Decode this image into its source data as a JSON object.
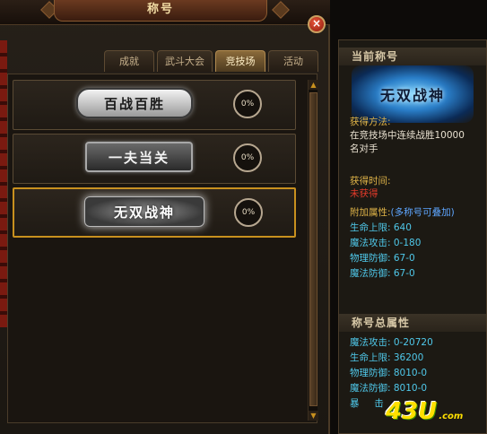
{
  "window": {
    "title": "称号",
    "close_label": "×"
  },
  "tabs": [
    {
      "label": "成就",
      "active": false
    },
    {
      "label": "武斗大会",
      "active": false
    },
    {
      "label": "竞技场",
      "active": true
    },
    {
      "label": "活动",
      "active": false
    }
  ],
  "titles": [
    {
      "badge_text": "百战百胜",
      "progress": "0%",
      "selected": false
    },
    {
      "badge_text": "一夫当关",
      "progress": "0%",
      "selected": false
    },
    {
      "badge_text": "无双战神",
      "progress": "0%",
      "selected": true
    }
  ],
  "scrollbar": {
    "up_label": "▲",
    "down_label": "▼"
  },
  "detail": {
    "current_header": "当前称号",
    "current_badge_text": "无双战神",
    "method_label": "获得方法:",
    "method_text_1": "在竞技场中连续战胜10000",
    "method_text_2": "名对手",
    "time_label": "获得时间:",
    "time_value": "未获得",
    "bonus_label": "附加属性:",
    "bonus_note": "(多称号可叠加)",
    "attrs": [
      "生命上限: 640",
      "魔法攻击: 0-180",
      "物理防御: 67-0",
      "魔法防御: 67-0"
    ],
    "total_header": "称号总属性",
    "total_attrs": [
      "魔法攻击: 0-20720",
      "生命上限: 36200",
      "物理防御: 8010-0",
      "魔法防御: 8010-0",
      "暴     击"
    ]
  },
  "watermark": {
    "big": "43U",
    "small": ".com"
  }
}
